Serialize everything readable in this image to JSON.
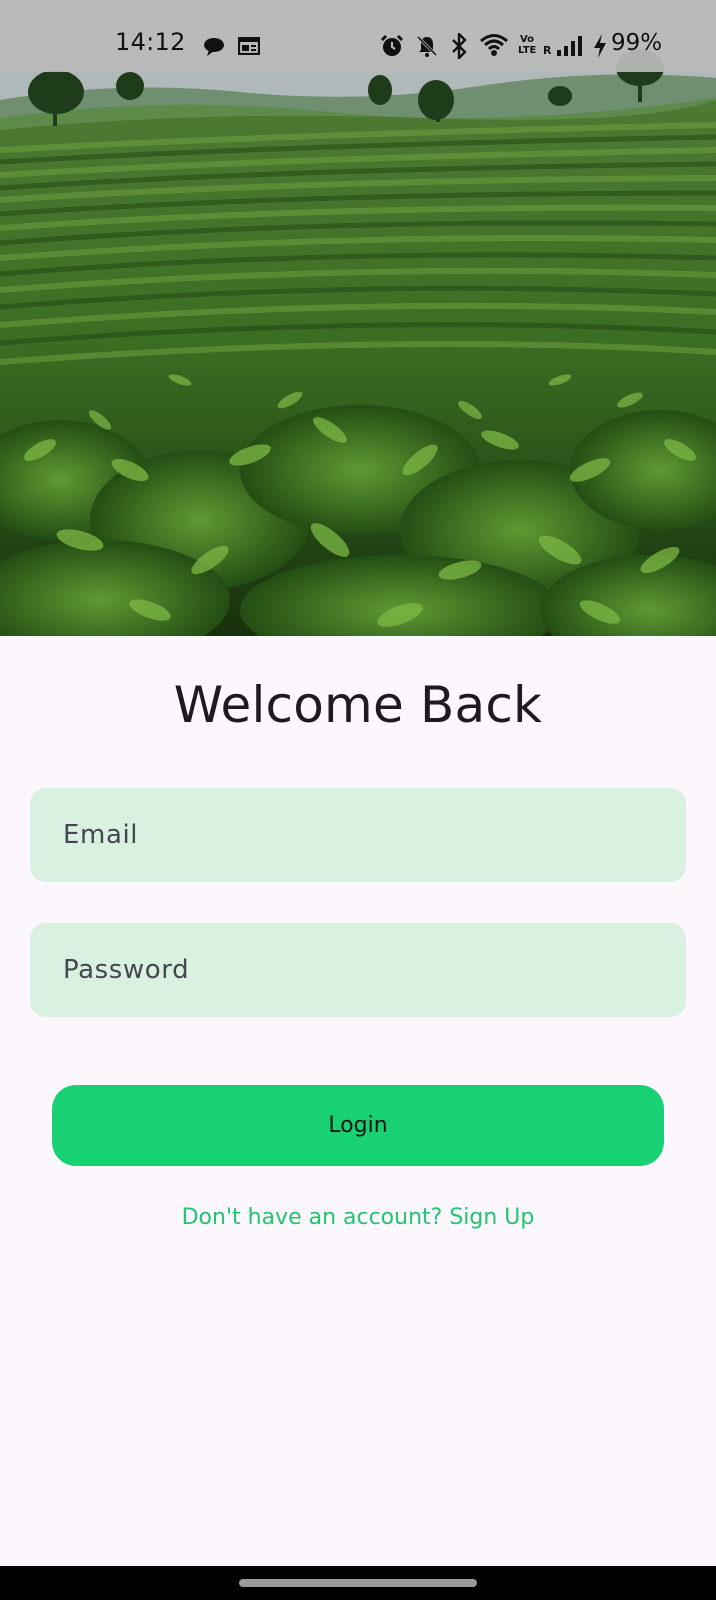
{
  "status_bar": {
    "time": "14:12",
    "battery": "99%",
    "icons": [
      "chat-bubble-icon",
      "news-icon",
      "alarm-icon",
      "bell-off-icon",
      "bluetooth-icon",
      "wifi-icon",
      "volte-icon",
      "roaming-r-icon",
      "signal-icon",
      "charging-bolt-icon"
    ],
    "volte_label": "Vo",
    "lte_label": "LTE",
    "roaming_label": "R"
  },
  "hero": {
    "image": "tea-plantation-landscape"
  },
  "login": {
    "title": "Welcome Back",
    "email_placeholder": "Email",
    "password_placeholder": "Password",
    "login_label": "Login",
    "signup_prompt": "Don't have an account? Sign Up"
  },
  "colors": {
    "background": "#fcf6fd",
    "field_background": "#d8f1e0",
    "accent": "#17d172",
    "link": "#1fc66e"
  }
}
